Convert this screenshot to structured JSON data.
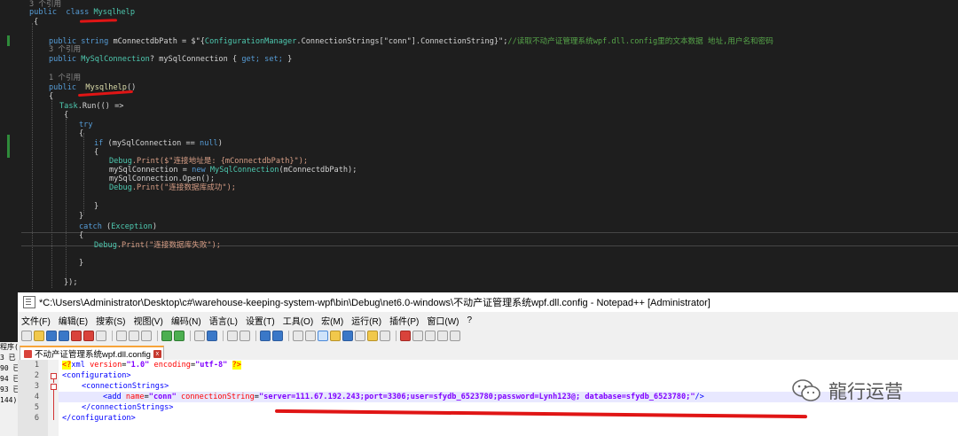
{
  "vs_editor": {
    "lines": [
      {
        "ref": "3 个引用"
      },
      {
        "kw": "public  class ",
        "ty": "Mysqlhelp"
      },
      {
        "text": "{"
      },
      {
        "kw": "public string ",
        "text": "mConnectdbPath = $\"{",
        "ty": "ConfigurationManager",
        "text2": ".ConnectionStrings[\"conn\"].ConnectionString}\";",
        "comment": "//读取不动产证管理系统wpf.dll.config里的文本数据 地址,用户名和密码"
      },
      {
        "ref": "3 个引用"
      },
      {
        "kw": "public ",
        "ty": "MySqlConnection",
        "text": "? mySqlConnection { ",
        "kw2": "get; set;",
        "text2": " }"
      },
      {
        "ref": "1 个引用"
      },
      {
        "kw": "public  ",
        "fn": "Mysqlhelp",
        "text": "()"
      },
      {
        "text": "{"
      },
      {
        "ty": "Task",
        "text": ".Run(() =>"
      },
      {
        "text": "{"
      },
      {
        "kw": "try"
      },
      {
        "text": "{"
      },
      {
        "kw": "if ",
        "text": "(mySqlConnection == ",
        "kw2": "null",
        "text2": ")"
      },
      {
        "text": "{"
      },
      {
        "ty": "Debug",
        "text": ".Print($\"连接地址是: {mConnectdbPath}\");"
      },
      {
        "text": "mySqlConnection = ",
        "kw": "new ",
        "ty": "MySqlConnection",
        "text2": "(mConnectdbPath);"
      },
      {
        "text": "mySqlConnection.Open();"
      },
      {
        "ty": "Debug",
        "text": ".Print(\"连接数据库成功\");"
      },
      {
        "text": "}"
      },
      {
        "text": "}"
      },
      {
        "kw": "catch ",
        "text": "(",
        "ty": "Exception",
        "text2": ")"
      },
      {
        "text": "{"
      },
      {
        "ty": "Debug",
        "text": ".Print(\"连接数据库失败\");"
      },
      {
        "text": "}"
      },
      {
        "text": "});"
      }
    ]
  },
  "left_panel_fragments": [
    "程序(S)",
    "3 已",
    "90 已",
    "94 已",
    "93 已",
    "144)"
  ],
  "notepad": {
    "title": "*C:\\Users\\Administrator\\Desktop\\c#\\warehouse-keeping-system-wpf\\bin\\Debug\\net6.0-windows\\不动产证管理系统wpf.dll.config - Notepad++ [Administrator]",
    "menu": [
      "文件(F)",
      "编辑(E)",
      "搜索(S)",
      "视图(V)",
      "编码(N)",
      "语言(L)",
      "设置(T)",
      "工具(O)",
      "宏(M)",
      "运行(R)",
      "插件(P)",
      "窗口(W)",
      "?"
    ],
    "tab_label": "不动产证管理系统wpf.dll.config",
    "tab_close": "x",
    "line_numbers": [
      "1",
      "2",
      "3",
      "4",
      "5",
      "6"
    ],
    "code": {
      "l1_open": "<?",
      "l1_name": "xml",
      "l1_a1": " version",
      "l1_eq1": "=",
      "l1_v1": "\"1.0\"",
      "l1_a2": " encoding",
      "l1_eq2": "=",
      "l1_v2": "\"utf-8\"",
      "l1_close": "?>",
      "l2": "<configuration>",
      "l3": "<connectionStrings>",
      "l4_tag": "<add",
      "l4_a1": " name",
      "l4_eq1": "=",
      "l4_v1": "\"conn\"",
      "l4_a2": " connectionString",
      "l4_eq2": "=",
      "l4_v2": "\"server=111.67.192.243;port=3306;user=sfydb_6523780;password=Lynh123@; database=sfydb_6523780;\"",
      "l4_end": "/>",
      "l5": "</connectionStrings>",
      "l6": "</configuration>"
    }
  },
  "watermark": {
    "text": "龍行运营"
  }
}
